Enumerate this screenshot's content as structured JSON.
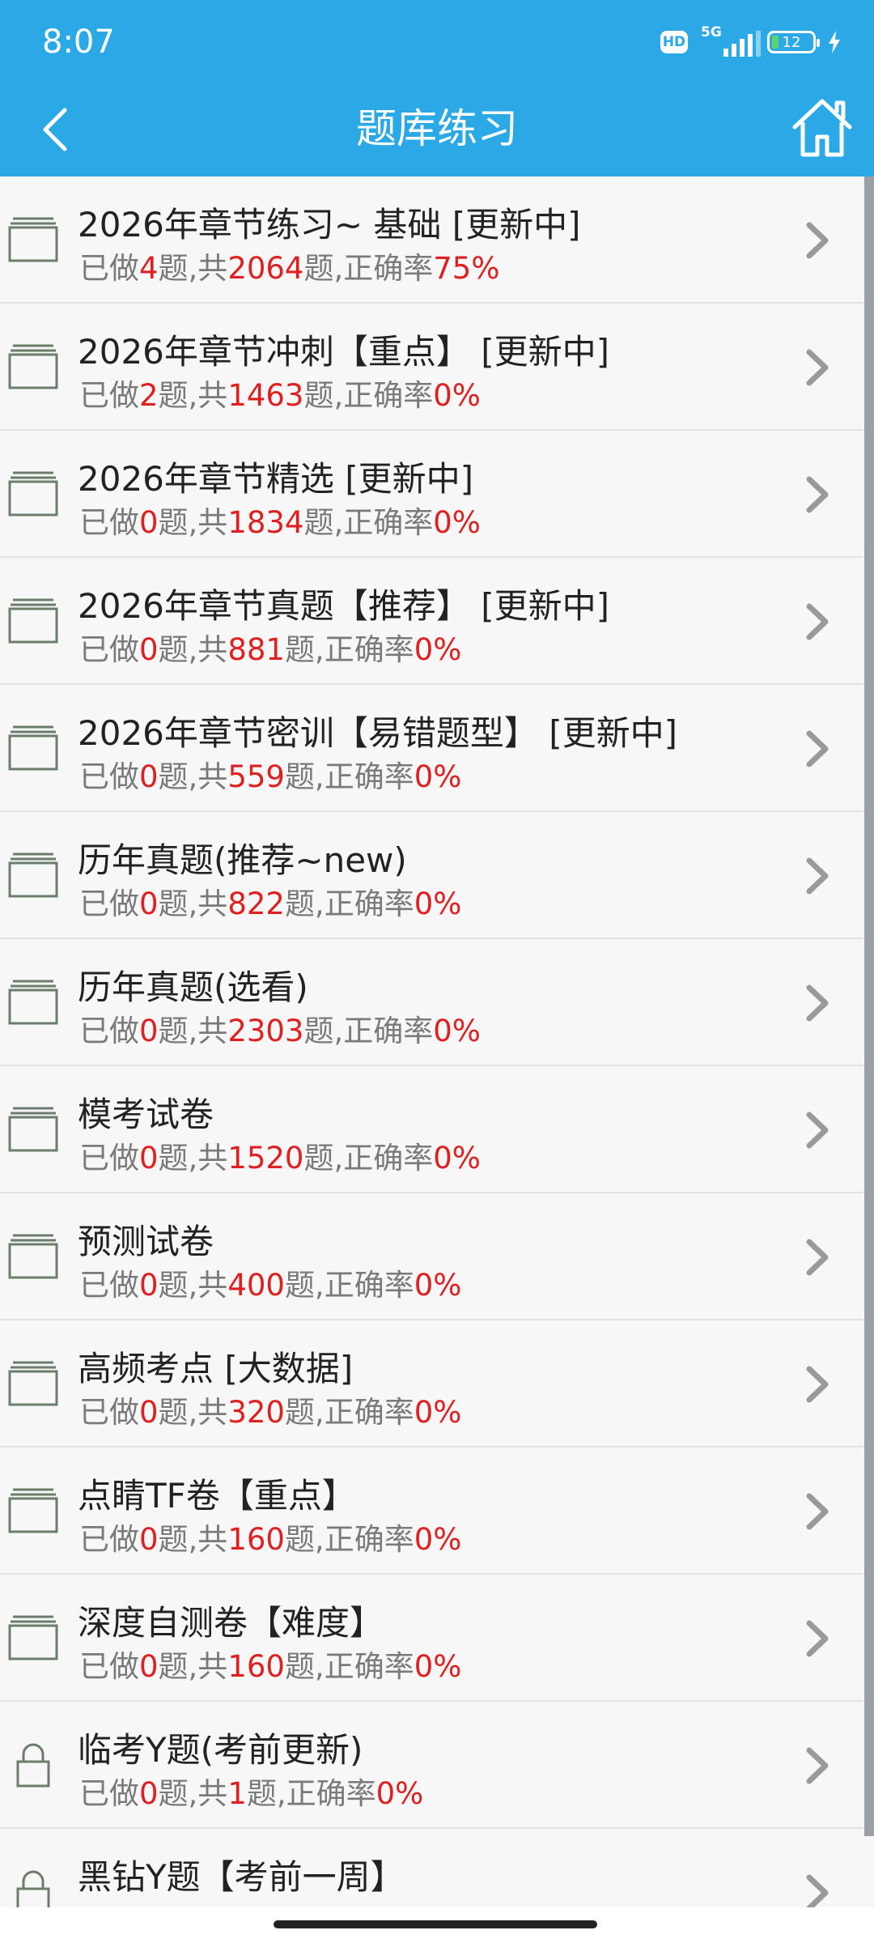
{
  "status": {
    "time": "8:07",
    "hd": "HD",
    "network": "5G",
    "battery": "12"
  },
  "header": {
    "title": "题库练习",
    "back_icon": "chevron-left-icon",
    "home_icon": "home-icon"
  },
  "stats_labels": {
    "done_prefix": "已做",
    "done_suffix": "题,共",
    "total_suffix": "题,正确率"
  },
  "items": [
    {
      "name": "2026年章节练习~ 基础 [更新中]",
      "done": "4",
      "total": "2064",
      "rate": "75%",
      "icon": "folder-icon"
    },
    {
      "name": "2026年章节冲刺【重点】 [更新中]",
      "done": "2",
      "total": "1463",
      "rate": "0%",
      "icon": "folder-icon"
    },
    {
      "name": "2026年章节精选 [更新中]",
      "done": "0",
      "total": "1834",
      "rate": "0%",
      "icon": "folder-icon"
    },
    {
      "name": "2026年章节真题【推荐】 [更新中]",
      "done": "0",
      "total": "881",
      "rate": "0%",
      "icon": "folder-icon"
    },
    {
      "name": "2026年章节密训【易错题型】 [更新中]",
      "done": "0",
      "total": "559",
      "rate": "0%",
      "icon": "folder-icon"
    },
    {
      "name": "历年真题(推荐~new)",
      "done": "0",
      "total": "822",
      "rate": "0%",
      "icon": "folder-icon"
    },
    {
      "name": "历年真题(选看)",
      "done": "0",
      "total": "2303",
      "rate": "0%",
      "icon": "folder-icon"
    },
    {
      "name": "模考试卷",
      "done": "0",
      "total": "1520",
      "rate": "0%",
      "icon": "folder-icon"
    },
    {
      "name": "预测试卷",
      "done": "0",
      "total": "400",
      "rate": "0%",
      "icon": "folder-icon"
    },
    {
      "name": "高频考点 [大数据]",
      "done": "0",
      "total": "320",
      "rate": "0%",
      "icon": "folder-icon"
    },
    {
      "name": "点睛TF卷【重点】",
      "done": "0",
      "total": "160",
      "rate": "0%",
      "icon": "folder-icon"
    },
    {
      "name": "深度自测卷【难度】",
      "done": "0",
      "total": "160",
      "rate": "0%",
      "icon": "folder-icon"
    },
    {
      "name": "临考Y题(考前更新)",
      "done": "0",
      "total": "1",
      "rate": "0%",
      "icon": "lock-icon"
    },
    {
      "name": "黑钻Y题【考前一周】",
      "done": "",
      "total": "",
      "rate": "",
      "icon": "lock-icon"
    }
  ],
  "colors": {
    "header_bg": "#2aa9e6",
    "highlight": "#e02020",
    "icon_stroke": "#6b7d6b"
  }
}
